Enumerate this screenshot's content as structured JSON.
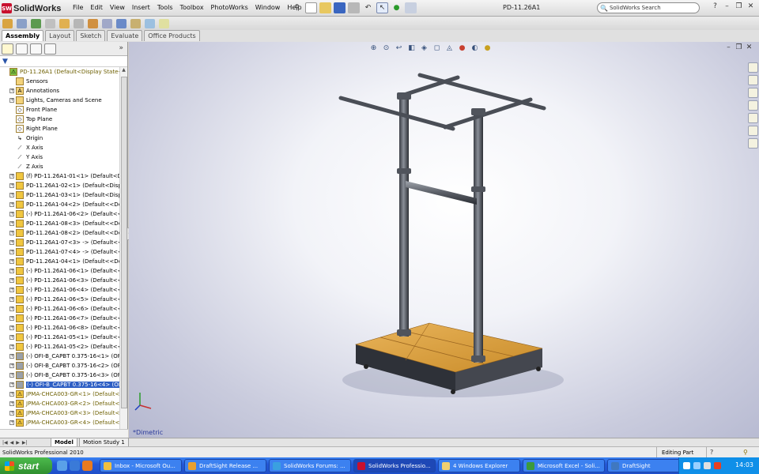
{
  "app": {
    "logo_text": "SolidWorks",
    "document_title": "PD-11.26A1",
    "search_placeholder": "SolidWorks Search"
  },
  "menu": [
    "File",
    "Edit",
    "View",
    "Insert",
    "Tools",
    "Toolbox",
    "PhotoWorks",
    "Window",
    "Help"
  ],
  "command_tabs": [
    {
      "label": "Assembly",
      "active": true
    },
    {
      "label": "Layout",
      "active": false
    },
    {
      "label": "Sketch",
      "active": false
    },
    {
      "label": "Evaluate",
      "active": false
    },
    {
      "label": "Office Products",
      "active": false
    }
  ],
  "tree": {
    "root": "PD-11.26A1  (Default<Display State-1",
    "items": [
      {
        "label": "Sensors",
        "type": "folder"
      },
      {
        "label": "Annotations",
        "type": "annotation",
        "expand": true
      },
      {
        "label": "Lights, Cameras and Scene",
        "type": "light",
        "expand": true
      },
      {
        "label": "Front Plane",
        "type": "plane"
      },
      {
        "label": "Top Plane",
        "type": "plane"
      },
      {
        "label": "Right Plane",
        "type": "plane"
      },
      {
        "label": "Origin",
        "type": "origin"
      },
      {
        "label": "X Axis",
        "type": "axis"
      },
      {
        "label": "Y Axis",
        "type": "axis"
      },
      {
        "label": "Z Axis",
        "type": "axis"
      },
      {
        "label": "(f) PD-11.26A1-01<1> (Default<Displ",
        "type": "part",
        "expand": true
      },
      {
        "label": "PD-11.26A1-02<1> (Default<Display",
        "type": "part",
        "expand": true
      },
      {
        "label": "PD-11.26A1-03<1> (Default<Display",
        "type": "part",
        "expand": true
      },
      {
        "label": "PD-11.26A1-04<2> (Default<<Defau",
        "type": "part",
        "expand": true
      },
      {
        "label": "(-) PD-11.26A1-06<2> (Default<<De",
        "type": "part",
        "expand": true
      },
      {
        "label": "PD-11.26A1-08<3> (Default<<Defau",
        "type": "part",
        "expand": true
      },
      {
        "label": "PD-11.26A1-08<2> (Default<<Defau",
        "type": "part",
        "expand": true
      },
      {
        "label": "PD-11.26A1-07<3> -> (Default<<De",
        "type": "part",
        "expand": true
      },
      {
        "label": "PD-11.26A1-07<4> -> (Default<<De",
        "type": "part",
        "expand": true
      },
      {
        "label": "PD-11.26A1-04<1> (Default<<Defau",
        "type": "part",
        "expand": true
      },
      {
        "label": "(-) PD-11.26A1-06<1> (Default<<De",
        "type": "part",
        "expand": true
      },
      {
        "label": "(-) PD-11.26A1-06<3> (Default<<De",
        "type": "part",
        "expand": true
      },
      {
        "label": "(-) PD-11.26A1-06<4> (Default<<De",
        "type": "part",
        "expand": true
      },
      {
        "label": "(-) PD-11.26A1-06<5> (Default<<De",
        "type": "part",
        "expand": true
      },
      {
        "label": "(-) PD-11.26A1-06<6> (Default<<De",
        "type": "part",
        "expand": true
      },
      {
        "label": "(-) PD-11.26A1-06<7> (Default<<De",
        "type": "part",
        "expand": true
      },
      {
        "label": "(-) PD-11.26A1-06<8> (Default<<De",
        "type": "part",
        "expand": true
      },
      {
        "label": "(-) PD-11.26A1-05<1> (Default<<De",
        "type": "part",
        "expand": true
      },
      {
        "label": "(-) PD-11.26A1-05<2> (Default<<De",
        "type": "part",
        "expand": true
      },
      {
        "label": "(-) OFI-B_CAPBT 0.375-16<1> (OFI-E",
        "type": "fastener",
        "expand": true
      },
      {
        "label": "(-) OFI-B_CAPBT 0.375-16<2> (OFI-E",
        "type": "fastener",
        "expand": true
      },
      {
        "label": "(-) OFI-B_CAPBT 0.375-16<3> (OFI-E",
        "type": "fastener",
        "expand": true
      },
      {
        "label": "(-) OFI-B_CAPBT 0.375-16<4> (OFI-E",
        "type": "fastener",
        "expand": true,
        "selected": true
      },
      {
        "label": "JPMA-CHCA003-GR<1> (Default<",
        "type": "warn",
        "expand": true
      },
      {
        "label": "JPMA-CHCA003-GR<2> (Default<",
        "type": "warn",
        "expand": true
      },
      {
        "label": "JPMA-CHCA003-GR<3> (Default<",
        "type": "warn",
        "expand": true
      },
      {
        "label": "JPMA-CHCA003-GR<4> (Default<",
        "type": "warn",
        "expand": true
      }
    ]
  },
  "viewport": {
    "view_label": "*Dimetric",
    "accent": "#2a3a9a"
  },
  "model_tabs": [
    {
      "label": "Model",
      "active": true
    },
    {
      "label": "Motion Study 1",
      "active": false
    }
  ],
  "status": {
    "left": "SolidWorks Professional 2010",
    "mode": "Editing Part"
  },
  "taskbar": {
    "start_label": "start",
    "tasks": [
      {
        "label": "Inbox - Microsoft Ou...",
        "color": "#f0c040"
      },
      {
        "label": "DraftSight Release ...",
        "color": "#e8a030"
      },
      {
        "label": "SolidWorks Forums: ...",
        "color": "#3aa0e0"
      },
      {
        "label": "SolidWorks Professio...",
        "color": "#c8102e",
        "active": true
      },
      {
        "label": "4 Windows Explorer",
        "color": "#f0d070"
      },
      {
        "label": "Microsoft Excel - Soli...",
        "color": "#3c9a3c"
      },
      {
        "label": "DraftSight",
        "color": "#4078c0"
      }
    ],
    "clock": "14:03"
  }
}
